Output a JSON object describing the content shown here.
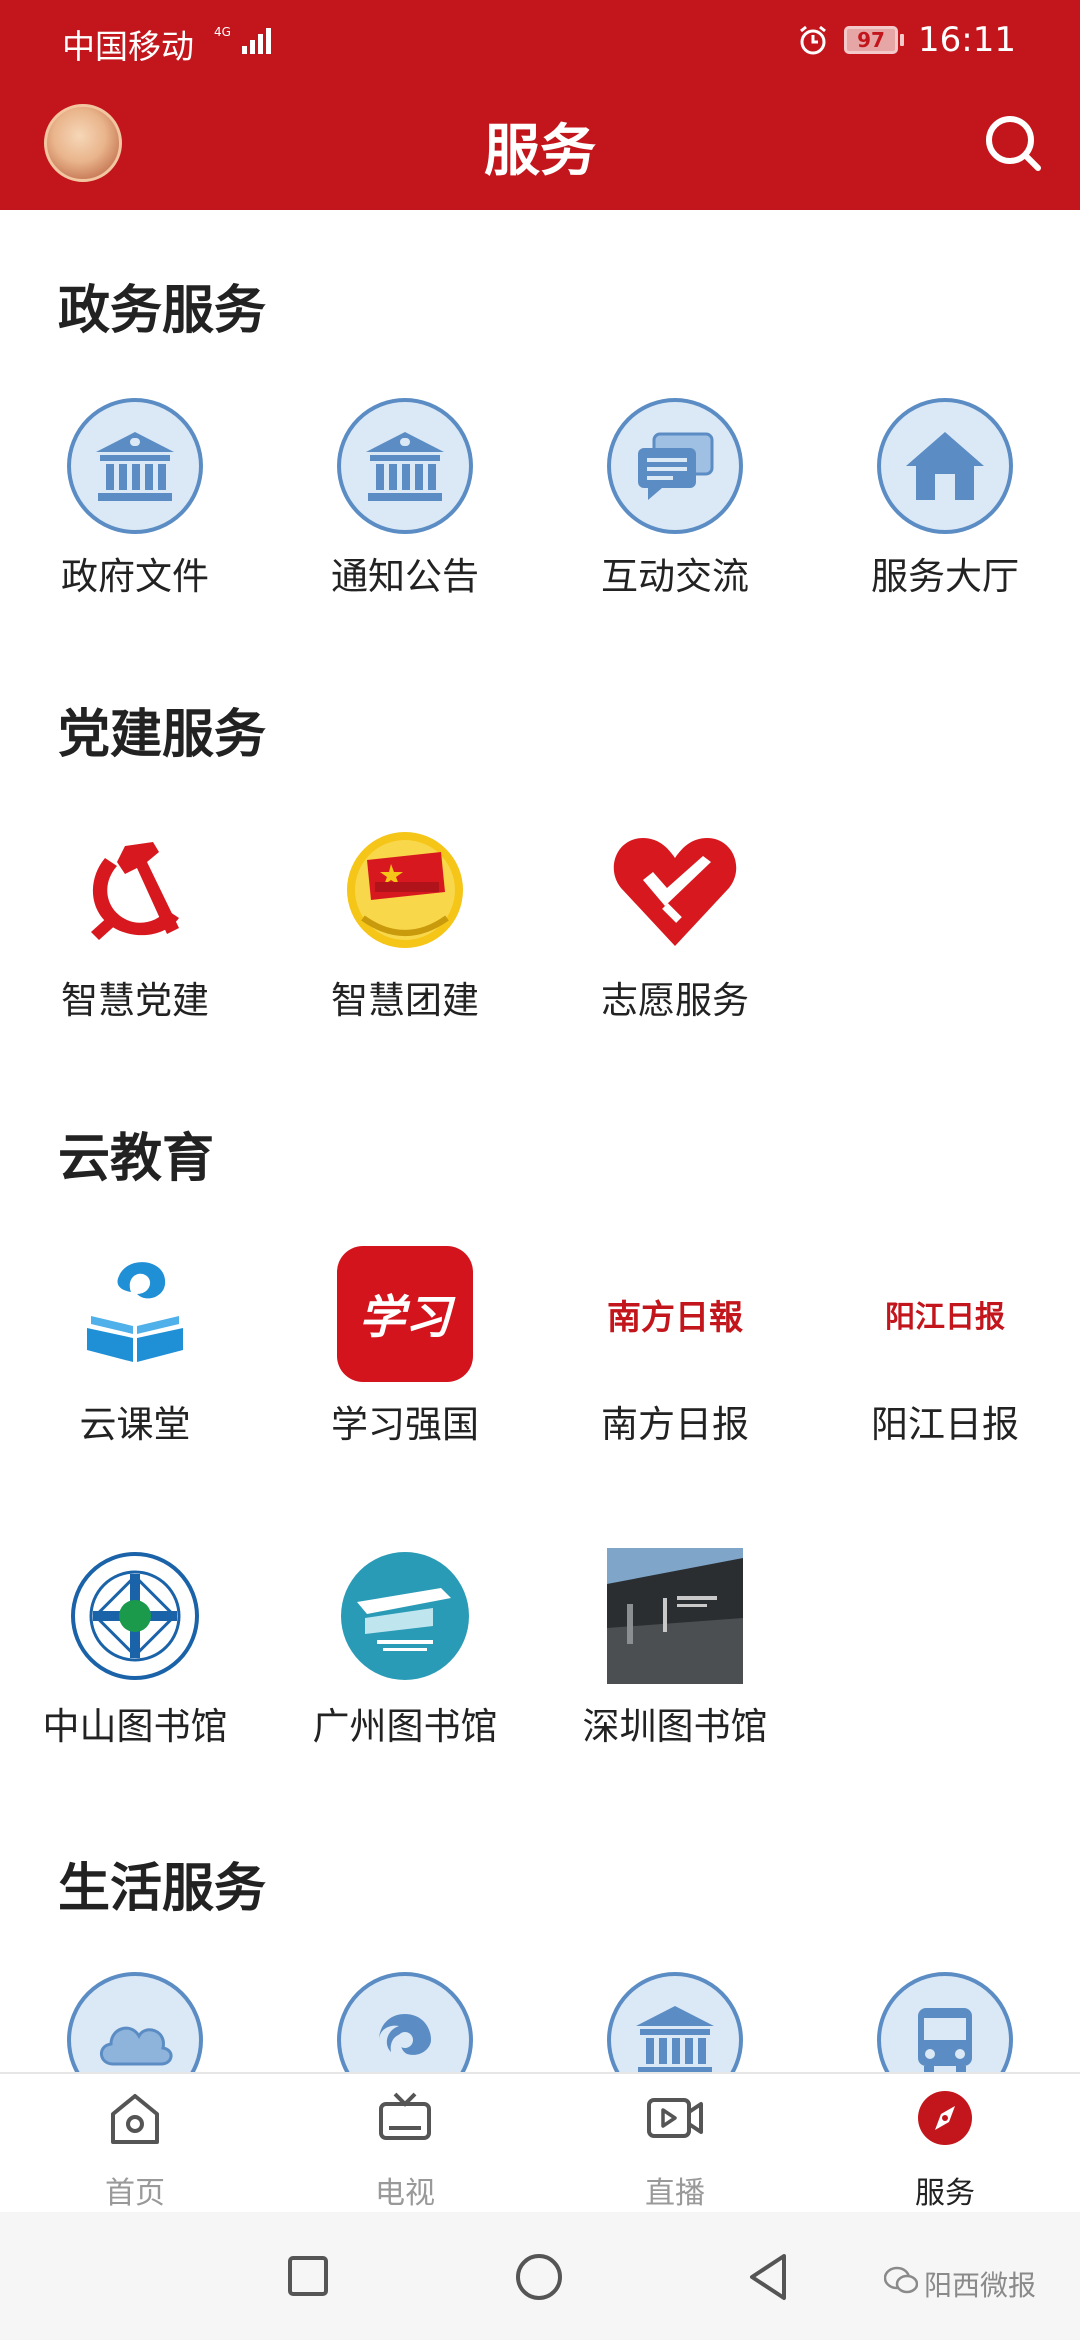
{
  "status": {
    "carrier": "中国移动",
    "net": "4G",
    "battery": "97",
    "time": "16:11"
  },
  "header": {
    "title": "服务"
  },
  "sections": [
    {
      "title": "政务服务",
      "items": [
        "政府文件",
        "通知公告",
        "互动交流",
        "服务大厅"
      ]
    },
    {
      "title": "党建服务",
      "items": [
        "智慧党建",
        "智慧团建",
        "志愿服务"
      ]
    },
    {
      "title": "云教育",
      "items": [
        "云课堂",
        "学习强国",
        "南方日报",
        "阳江日报",
        "中山图书馆",
        "广州图书馆",
        "深圳图书馆"
      ]
    },
    {
      "title": "生活服务"
    }
  ],
  "logos": {
    "xuexi": "学习",
    "nanfang": "南方日報",
    "yangjiang": "阳江日报"
  },
  "nav": [
    "首页",
    "电视",
    "直播",
    "服务"
  ],
  "watermark": "阳西微报",
  "colors": {
    "brand_red": "#c3161c",
    "icon_blue": "#5b8dc4",
    "icon_fill": "#dbe8f6",
    "nav_inactive": "#999999"
  }
}
